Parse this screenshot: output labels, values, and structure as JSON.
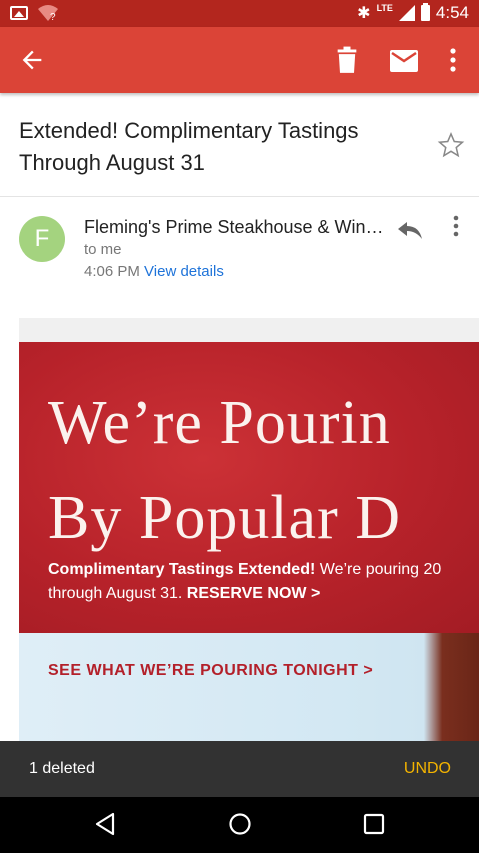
{
  "status_bar": {
    "time": "4:54",
    "network": "LTE",
    "icons": [
      "image-icon",
      "wifi-question-icon",
      "bluetooth-icon",
      "signal-icon",
      "battery-icon"
    ]
  },
  "app_bar": {
    "background": "#db4437",
    "icons": [
      "back-arrow-icon",
      "delete-icon",
      "mail-icon",
      "more-vert-icon"
    ]
  },
  "email": {
    "subject": "Extended! Complimentary Tastings Through August 31",
    "sender_initial": "F",
    "sender_name": "Fleming's Prime Steakhouse & Win…",
    "recipient": "to me",
    "time": "4:06 PM",
    "view_details": "View details",
    "avatar_color": "#a4d37f"
  },
  "body": {
    "headline_line1": "We’re Pourin",
    "headline_line2": "By Popular D",
    "sub_bold": "Complimentary Tastings Extended!",
    "sub_text": " We’re pouring 20",
    "sub_line2": "through August 31. ",
    "sub_cta": "RESERVE NOW >",
    "tonight_link": "SEE WHAT WE’RE POURING TONIGHT >"
  },
  "snackbar": {
    "message": "1 deleted",
    "action": "UNDO",
    "action_color": "#f4b400"
  },
  "nav_bar": {
    "icons": [
      "nav-back-icon",
      "nav-home-icon",
      "nav-recents-icon"
    ]
  }
}
